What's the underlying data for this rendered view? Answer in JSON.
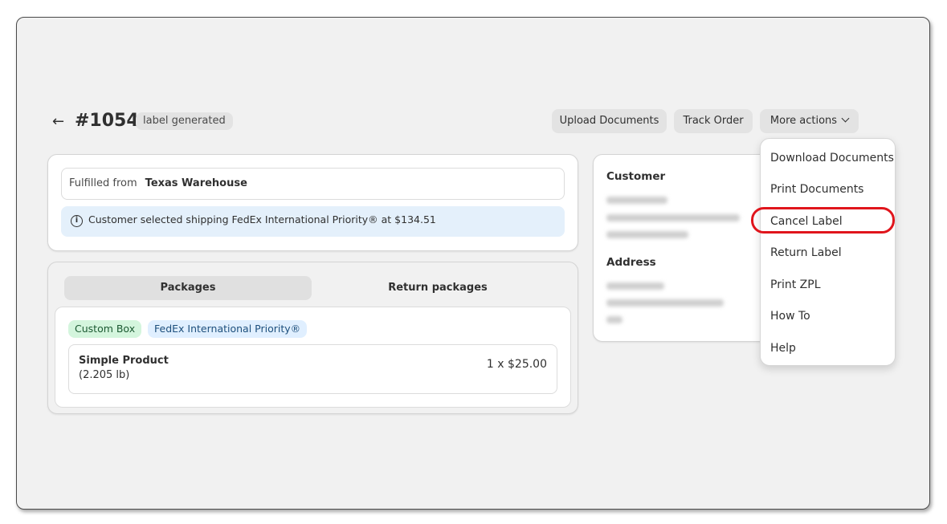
{
  "header": {
    "back_icon": "←",
    "order_title": "#1054",
    "status_badge": "label generated",
    "buttons": {
      "upload_documents": "Upload Documents",
      "track_order": "Track Order",
      "more_actions": "More actions"
    }
  },
  "fulfilled_card": {
    "from_label": "Fulfilled from",
    "warehouse": "Texas Warehouse",
    "info_icon": "i",
    "info_text": "Customer selected shipping FedEx International Priority® at $134.51"
  },
  "packages_card": {
    "tabs": [
      {
        "label": "Packages",
        "active": true
      },
      {
        "label": "Return packages",
        "active": false
      }
    ],
    "tags": {
      "box": "Custom Box",
      "service": "FedEx International Priority®"
    },
    "product": {
      "name": "Simple Product",
      "weight": "(2.205 lb)",
      "price": "1 x $25.00"
    }
  },
  "customer_card": {
    "customer_heading": "Customer",
    "address_heading": "Address"
  },
  "dropdown": {
    "items": [
      "Download Documents",
      "Print Documents",
      "Cancel Label",
      "Return Label",
      "Print ZPL",
      "How To",
      "Help"
    ],
    "highlighted_item": "Cancel Label",
    "highlight_color": "#e0151c"
  }
}
